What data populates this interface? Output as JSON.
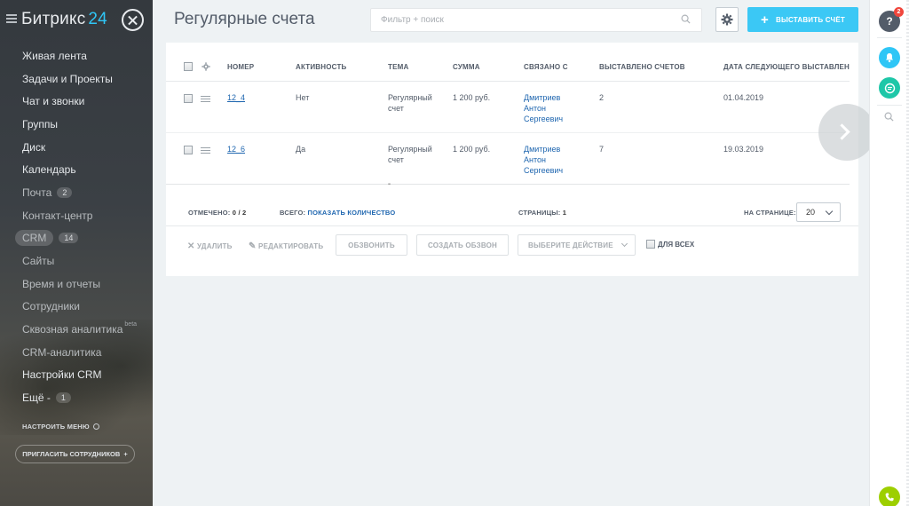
{
  "sidebar": {
    "logo_text": "Битрикс",
    "logo_number": "24",
    "items": [
      {
        "label": "Живая лента"
      },
      {
        "label": "Задачи и Проекты"
      },
      {
        "label": "Чат и звонки"
      },
      {
        "label": "Группы"
      },
      {
        "label": "Диск"
      },
      {
        "label": "Календарь"
      },
      {
        "label": "Почта",
        "badge": "2"
      },
      {
        "label": "Контакт-центр"
      },
      {
        "label": "CRM",
        "badge": "14"
      },
      {
        "label": "Сайты"
      },
      {
        "label": "Время и отчеты"
      },
      {
        "label": "Сотрудники"
      },
      {
        "label": "Сквозная аналитика",
        "sup": "beta"
      },
      {
        "label": "CRM-аналитика"
      },
      {
        "label": "Настройки CRM"
      },
      {
        "label": "Ещё -",
        "badge": "1"
      }
    ],
    "configure_label": "НАСТРОИТЬ МЕНЮ",
    "invite_label": "ПРИГЛАСИТЬ СОТРУДНИКОВ"
  },
  "header": {
    "title": "Регулярные счета",
    "filter_placeholder": "Фильтр + поиск",
    "add_button": "ВЫСТАВИТЬ СЧЁТ"
  },
  "grid": {
    "columns": [
      "НОМЕР",
      "АКТИВНОСТЬ",
      "ТЕМА",
      "СУММА",
      "СВЯЗАНО С",
      "ВЫСТАВЛЕНО СЧЕТОВ",
      "ДАТА СЛЕДУЮЩЕГО ВЫСТАВЛЕНИ"
    ],
    "rows": [
      {
        "number": "12_4",
        "active": "Нет",
        "topic": [
          "Регулярный",
          "счет"
        ],
        "sum": "1 200 руб.",
        "linked": [
          "Дмитриев",
          "Антон",
          "Сергеевич"
        ],
        "issued": "2",
        "next_date": "01.04.2019"
      },
      {
        "number": "12_6",
        "active": "Да",
        "topic": [
          "Регулярный",
          "счет"
        ],
        "sum": "1 200 руб.",
        "linked": [
          "Дмитриев",
          "Антон",
          "Сергеевич"
        ],
        "issued": "7",
        "next_date": "19.03.2019"
      }
    ]
  },
  "footer": {
    "selected_label": "ОТМЕЧЕНО:",
    "selected_value": "0 / 2",
    "total_label": "ВСЕГО:",
    "total_link": "ПОКАЗАТЬ КОЛИЧЕСТВО",
    "pages_label": "СТРАНИЦЫ:",
    "pages_value": "1",
    "per_page_label": "НА СТРАНИЦЕ:",
    "per_page_value": "20"
  },
  "actions": {
    "delete": "УДАЛИТЬ",
    "edit": "РЕДАКТИРОВАТЬ",
    "call": "ОБЗВОНИТЬ",
    "create_call": "СОЗДАТЬ ОБЗВОН",
    "choose_action": "ВЫБЕРИТЕ ДЕЙСТВИЕ",
    "for_all": "ДЛЯ ВСЕХ"
  },
  "rail": {
    "help_label": "?",
    "help_count": "2"
  },
  "colors": {
    "accent": "#3bc8f5",
    "link": "#2067b0",
    "bell": "#2fc6f6",
    "chat": "#1ec7a8",
    "phone": "#9dcf00",
    "counter": "#f0463c"
  }
}
